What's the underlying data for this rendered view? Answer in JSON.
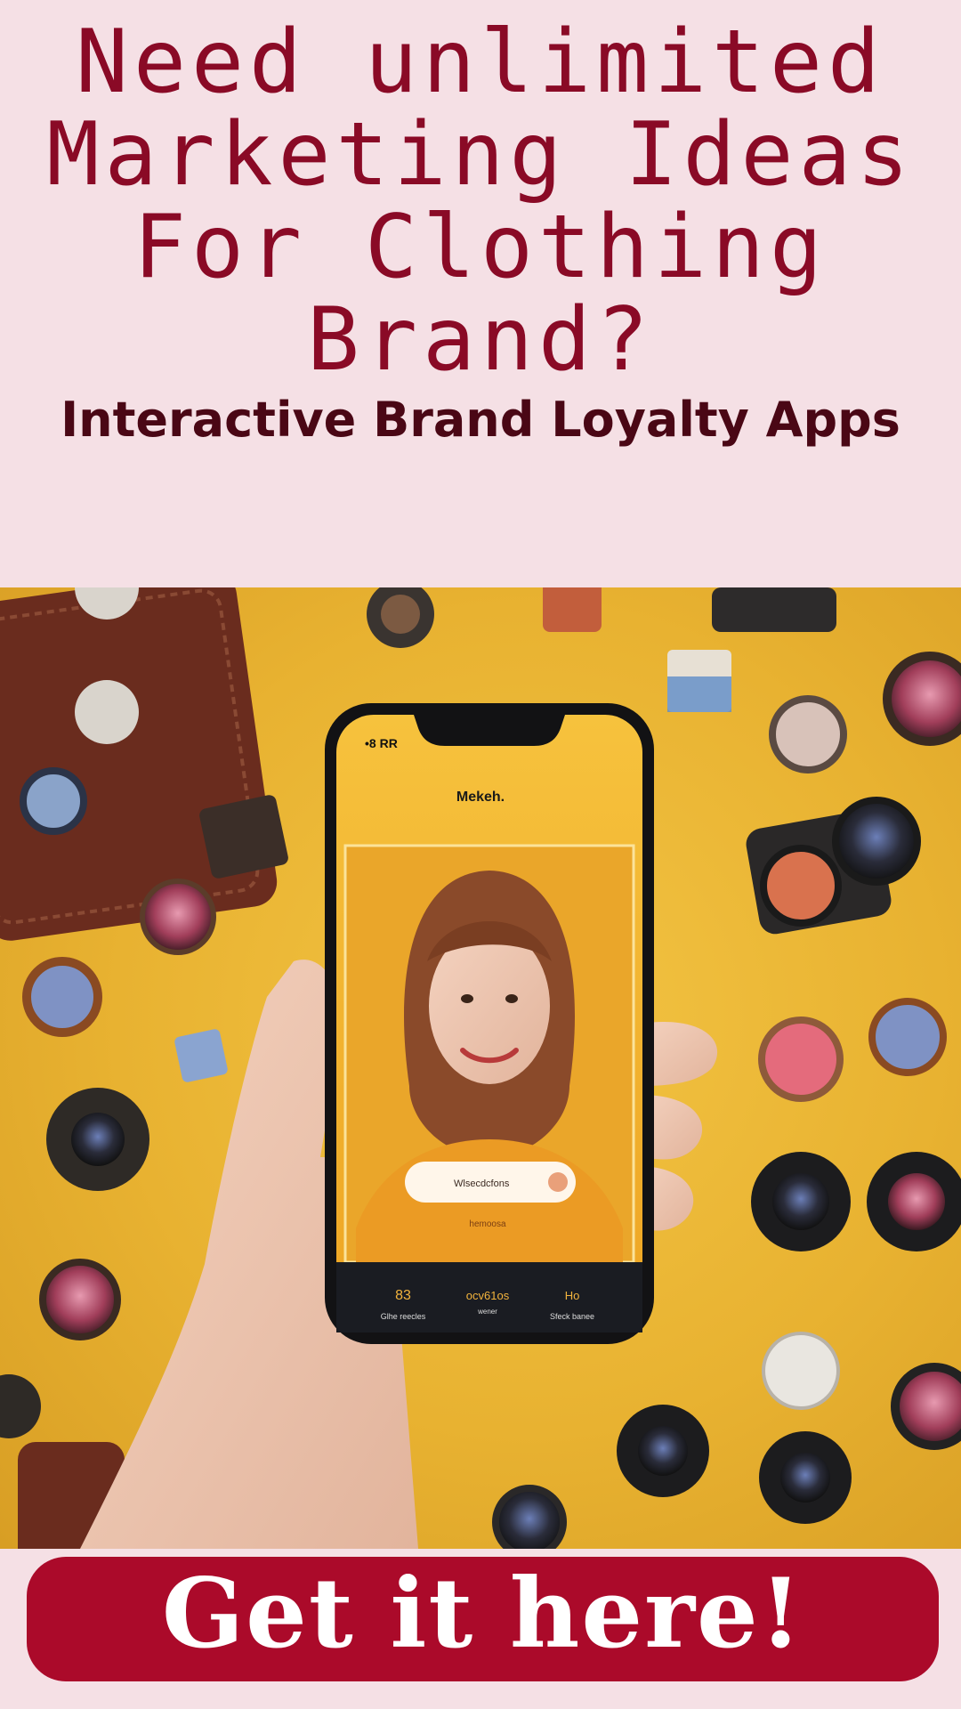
{
  "headline": {
    "lines": [
      "Need unlimited",
      "Marketing Ideas",
      "For Clothing",
      "Brand?"
    ],
    "color": "#8a0a26"
  },
  "subtitle": "Interactive Brand Loyalty Apps",
  "photo": {
    "background_color": "#e8b231",
    "phone": {
      "status_left": "•8 RR",
      "app_title": "Mekeh.",
      "pill_text": "Wlsecdcfons",
      "link_text": "hemoosa",
      "nav": [
        {
          "top": "83",
          "label": "Glhe reecles"
        },
        {
          "top": "ocv61os",
          "label": "wener"
        },
        {
          "top": "Ho",
          "label": "Sfeck banee"
        }
      ]
    }
  },
  "cta": {
    "label": "Get it here!",
    "background": "#ab0a2a"
  }
}
